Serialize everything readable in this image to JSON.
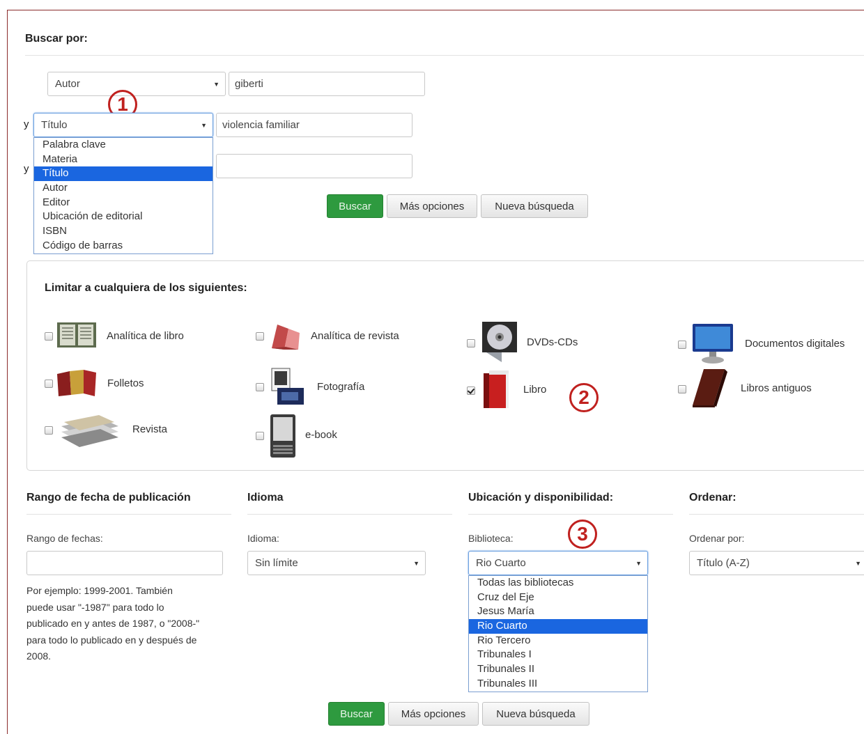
{
  "search": {
    "heading": "Buscar por:",
    "row1": {
      "field": "Autor",
      "value": "giberti"
    },
    "row2": {
      "conj": "y",
      "field": "Título",
      "value": "violencia familiar"
    },
    "row3": {
      "conj": "y",
      "value": ""
    },
    "field_options": [
      "Palabra clave",
      "Materia",
      "Título",
      "Autor",
      "Editor",
      "Ubicación de editorial",
      "ISBN",
      "Código de barras"
    ],
    "field_selected": "Título"
  },
  "buttons": {
    "search": "Buscar",
    "more": "Más opciones",
    "new": "Nueva búsqueda"
  },
  "markers": {
    "one": "1",
    "two": "2",
    "three": "3"
  },
  "limits": {
    "heading": "Limitar a cualquiera de los siguientes:",
    "items": [
      {
        "label": "Analítica de libro",
        "checked": false,
        "icon": "open-book-icon"
      },
      {
        "label": "Analítica de revista",
        "checked": false,
        "icon": "magazine-icon"
      },
      {
        "label": "DVDs-CDs",
        "checked": false,
        "icon": "disc-icon"
      },
      {
        "label": "Documentos digitales",
        "checked": false,
        "icon": "monitor-icon"
      },
      {
        "label": "Folletos",
        "checked": false,
        "icon": "brochure-icon"
      },
      {
        "label": "Fotografía",
        "checked": false,
        "icon": "photo-icon"
      },
      {
        "label": "Libro",
        "checked": true,
        "icon": "book-icon"
      },
      {
        "label": "Libros antiguos",
        "checked": false,
        "icon": "old-book-icon"
      },
      {
        "label": "Revista",
        "checked": false,
        "icon": "magazine-stack-icon"
      },
      {
        "label": "e-book",
        "checked": false,
        "icon": "ereader-icon"
      }
    ]
  },
  "date": {
    "heading": "Rango de fecha de publicación",
    "label": "Rango de fechas:",
    "value": "",
    "help": [
      "Por ejemplo: 1999-2001. También",
      "puede usar \"-1987\" para todo lo",
      "publicado en y antes de 1987, o \"2008-\"",
      "para todo lo publicado en y después de",
      "2008."
    ]
  },
  "language": {
    "heading": "Idioma",
    "label": "Idioma:",
    "value": "Sin límite"
  },
  "location": {
    "heading": "Ubicación y disponibilidad:",
    "label": "Biblioteca:",
    "value": "Rio Cuarto",
    "options": [
      "Todas las bibliotecas",
      "Cruz del Eje",
      "Jesus María",
      "Rio Cuarto",
      "Rio Tercero",
      "Tribunales I",
      "Tribunales II",
      "Tribunales III"
    ],
    "selected": "Rio Cuarto"
  },
  "sort": {
    "heading": "Ordenar:",
    "label": "Ordenar por:",
    "value": "Título (A-Z)"
  },
  "colors": {
    "accent_green": "#2e9a3f",
    "selection_blue": "#1a66e0",
    "marker_red": "#c0211f",
    "frame": "#8a2b2b"
  }
}
